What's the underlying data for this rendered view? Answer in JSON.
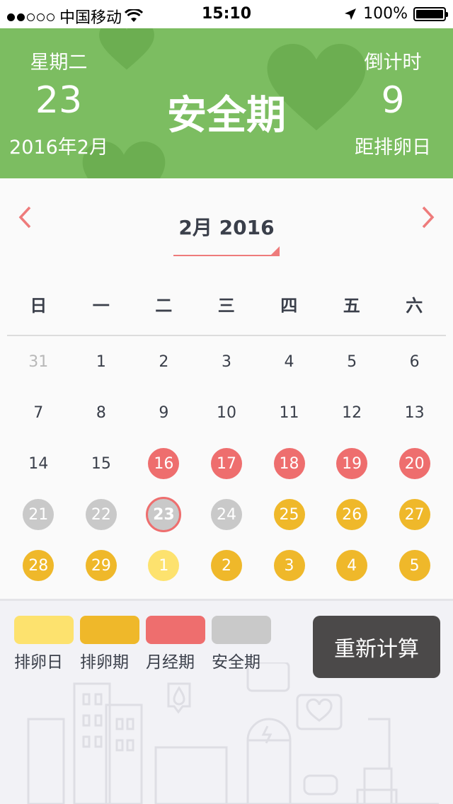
{
  "status_bar": {
    "carrier": "中国移动",
    "time": "15:10",
    "battery": "100%"
  },
  "header": {
    "weekday": "星期二",
    "day": "23",
    "year_month": "2016年2月",
    "phase": "安全期",
    "countdown_label": "倒计时",
    "countdown_value": "9",
    "countdown_sub": "距排卵日"
  },
  "calendar": {
    "month_title": "2月 2016",
    "weekdays": [
      "日",
      "一",
      "二",
      "三",
      "四",
      "五",
      "六"
    ],
    "weeks": [
      [
        {
          "d": "31",
          "t": "muted"
        },
        {
          "d": "1",
          "t": "normal"
        },
        {
          "d": "2",
          "t": "normal"
        },
        {
          "d": "3",
          "t": "normal"
        },
        {
          "d": "4",
          "t": "normal"
        },
        {
          "d": "5",
          "t": "normal"
        },
        {
          "d": "6",
          "t": "normal"
        }
      ],
      [
        {
          "d": "7",
          "t": "normal"
        },
        {
          "d": "8",
          "t": "normal"
        },
        {
          "d": "9",
          "t": "normal"
        },
        {
          "d": "10",
          "t": "normal"
        },
        {
          "d": "11",
          "t": "normal"
        },
        {
          "d": "12",
          "t": "normal"
        },
        {
          "d": "13",
          "t": "normal"
        }
      ],
      [
        {
          "d": "14",
          "t": "normal"
        },
        {
          "d": "15",
          "t": "normal"
        },
        {
          "d": "16",
          "t": "period"
        },
        {
          "d": "17",
          "t": "period"
        },
        {
          "d": "18",
          "t": "period"
        },
        {
          "d": "19",
          "t": "period"
        },
        {
          "d": "20",
          "t": "period"
        }
      ],
      [
        {
          "d": "21",
          "t": "safe"
        },
        {
          "d": "22",
          "t": "safe"
        },
        {
          "d": "23",
          "t": "today"
        },
        {
          "d": "24",
          "t": "safe"
        },
        {
          "d": "25",
          "t": "ovperiod"
        },
        {
          "d": "26",
          "t": "ovperiod"
        },
        {
          "d": "27",
          "t": "ovperiod"
        }
      ],
      [
        {
          "d": "28",
          "t": "ovperiod"
        },
        {
          "d": "29",
          "t": "ovperiod"
        },
        {
          "d": "1",
          "t": "ovday"
        },
        {
          "d": "2",
          "t": "ovperiod"
        },
        {
          "d": "3",
          "t": "ovperiod"
        },
        {
          "d": "4",
          "t": "ovperiod"
        },
        {
          "d": "5",
          "t": "ovperiod"
        }
      ]
    ]
  },
  "legend": [
    {
      "label": "排卵日",
      "color": "#fde26e"
    },
    {
      "label": "排卵期",
      "color": "#efb82a"
    },
    {
      "label": "月经期",
      "color": "#ee6e6e"
    },
    {
      "label": "安全期",
      "color": "#c9c9c9"
    }
  ],
  "recalc_label": "重新计算",
  "colors": {
    "header_green": "#7cbd61",
    "accent_red": "#ee7b7b",
    "button_dark": "#4b4949"
  },
  "icons": {
    "prev": "chevron-left-icon",
    "next": "chevron-right-icon",
    "wifi": "wifi-icon",
    "location": "location-arrow-icon",
    "battery": "battery-icon"
  }
}
